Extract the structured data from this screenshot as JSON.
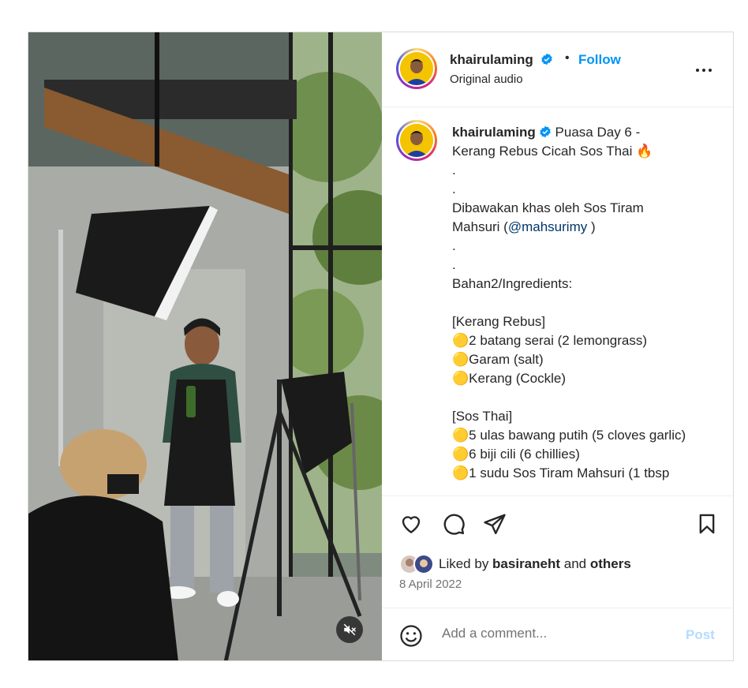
{
  "post": {
    "username": "khairulaming",
    "follow_label": "Follow",
    "separator": "•",
    "audio": "Original audio",
    "more_icon": "more-horizontal-icon",
    "caption": "Puasa Day 6 -\nKerang Rebus Cicah Sos Thai 🔥\n.\n.\nDibawakan khas oleh Sos Tiram Mahsuri (",
    "mention": "@mahsurimy",
    "caption_rest": " )\n.\n.\nBahan2/Ingredients:\n\n[Kerang Rebus]\n🟡2 batang serai (2 lemongrass)\n🟡Garam (salt)\n🟡Kerang (Cockle)\n\n[Sos Thai]\n🟡5 ulas bawang putih (5 cloves garlic)\n🟡6 biji cili (6 chillies)\n🟡1 sudu Sos Tiram Mahsuri (1 tbsp",
    "liked_prefix": "Liked by ",
    "liked_user": "basiraneht",
    "liked_mid": " and ",
    "liked_others": "others",
    "date": "8 April 2022",
    "comment_placeholder": "Add a comment...",
    "post_label": "Post"
  },
  "colors": {
    "accent": "#0095f6",
    "verified": "#0095f6",
    "mention": "#00376b",
    "post_disabled": "#b3dbff",
    "muted_text": "#737373"
  },
  "icons": {
    "like": "heart-icon",
    "comment": "comment-icon",
    "share": "share-icon",
    "save": "bookmark-icon",
    "emoji": "emoji-icon",
    "mute": "muted-speaker-icon",
    "verified": "verified-badge-icon"
  }
}
